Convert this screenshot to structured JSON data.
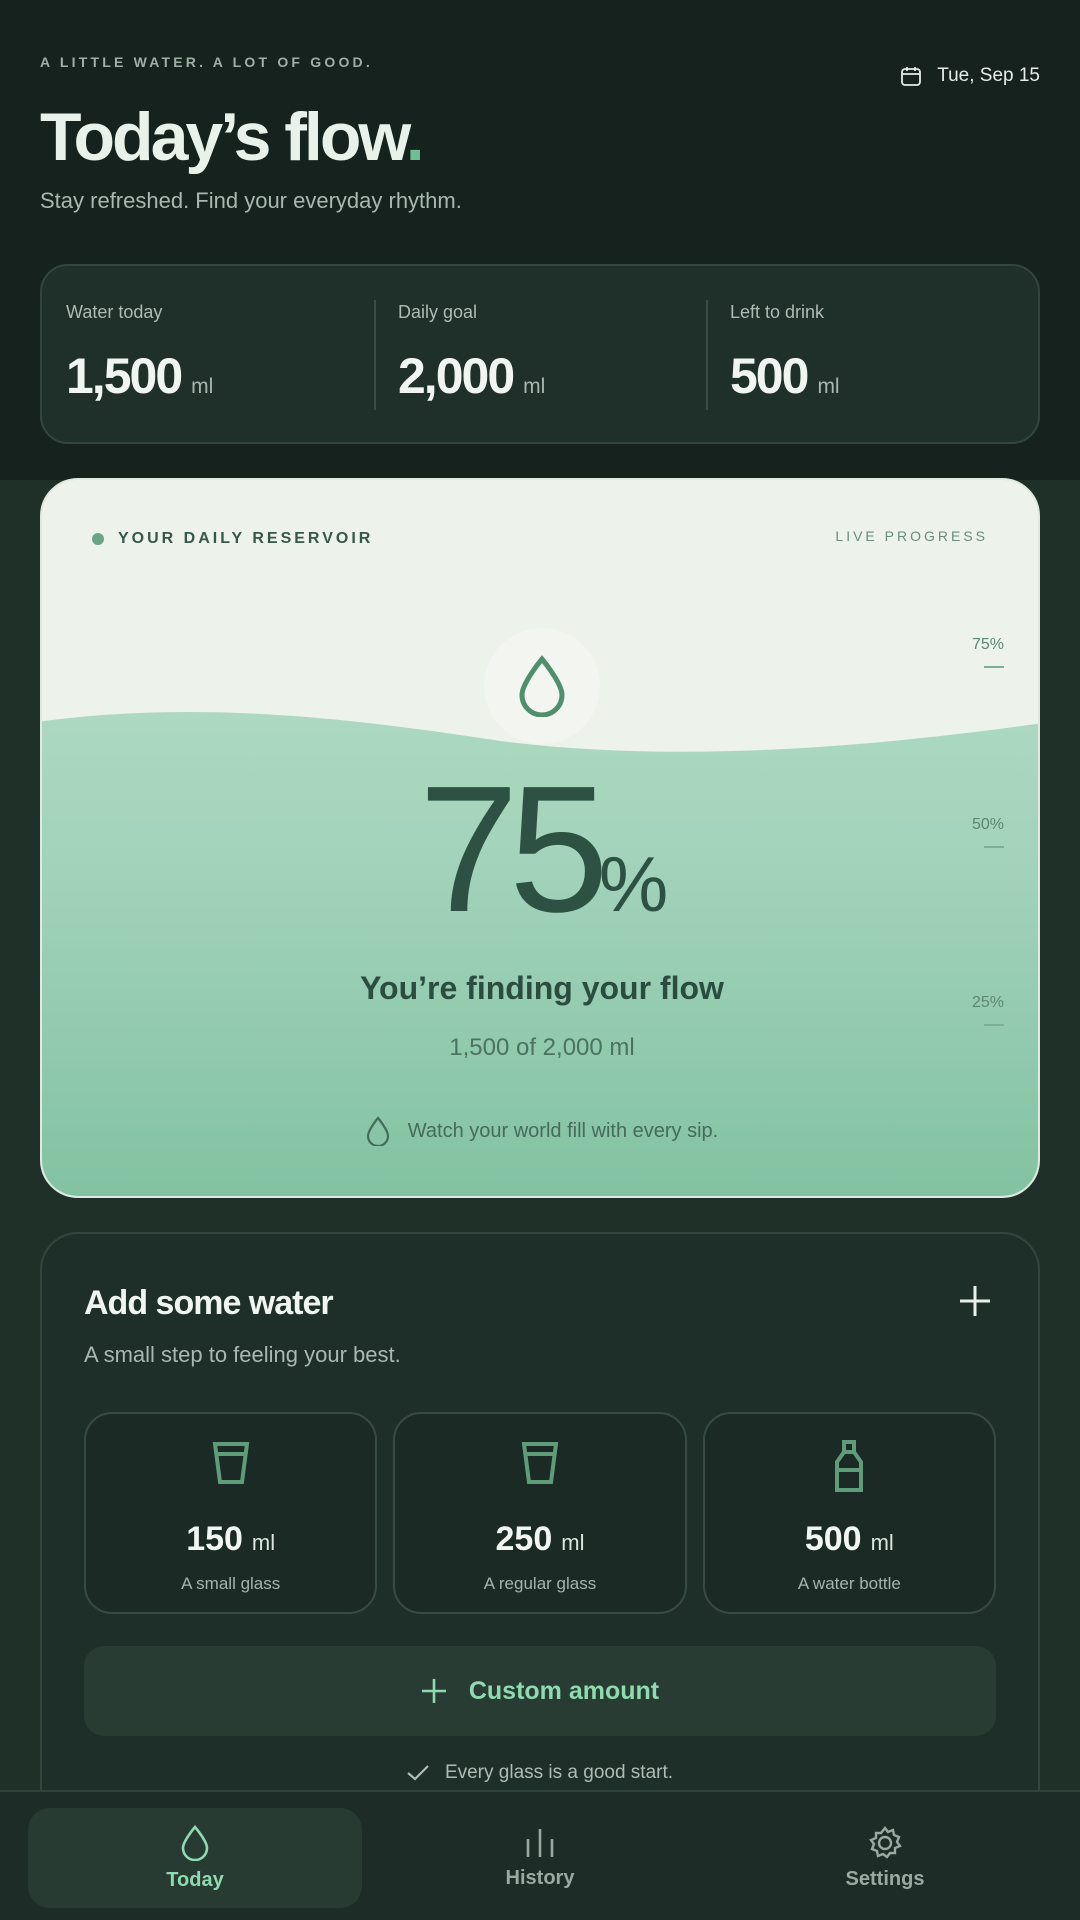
{
  "header": {
    "tagline": "A LITTLE WATER. A LOT OF GOOD.",
    "date": "Tue, Sep 15",
    "title_main": "Today’s flow",
    "title_dot": ".",
    "subtitle": "Stay refreshed. Find your everyday rhythm."
  },
  "stats": [
    {
      "label": "Water today",
      "value": "1,500",
      "unit": "ml"
    },
    {
      "label": "Daily goal",
      "value": "2,000",
      "unit": "ml"
    },
    {
      "label": "Left to drink",
      "value": "500",
      "unit": "ml"
    }
  ],
  "reservoir": {
    "label": "YOUR DAILY RESERVOIR",
    "live": "LIVE PROGRESS",
    "percent": "75",
    "percent_sign": "%",
    "fill_fraction": 0.75,
    "message": "You’re finding your flow",
    "amount": "1,500 of 2,000 ml",
    "watch": "Watch your world fill with every sip.",
    "ticks": [
      "75%",
      "50%",
      "25%"
    ]
  },
  "add": {
    "title": "Add some water",
    "subtitle": "A small step to feeling your best.",
    "presets": [
      {
        "amount": "150",
        "unit": "ml",
        "desc": "A small glass",
        "icon": "glass-icon"
      },
      {
        "amount": "250",
        "unit": "ml",
        "desc": "A regular glass",
        "icon": "glass-icon"
      },
      {
        "amount": "500",
        "unit": "ml",
        "desc": "A water bottle",
        "icon": "bottle-icon"
      }
    ],
    "custom_label": "Custom amount",
    "hint": "Every glass is a good start."
  },
  "nav": [
    {
      "label": "Today",
      "icon": "drop-icon",
      "active": true
    },
    {
      "label": "History",
      "icon": "bars-icon",
      "active": false
    },
    {
      "label": "Settings",
      "icon": "gear-icon",
      "active": false
    }
  ],
  "colors": {
    "background": "#15221d",
    "accent": "#8fdaaf",
    "water_light": "#a9d8bd",
    "water_dark": "#7ebf9e"
  }
}
